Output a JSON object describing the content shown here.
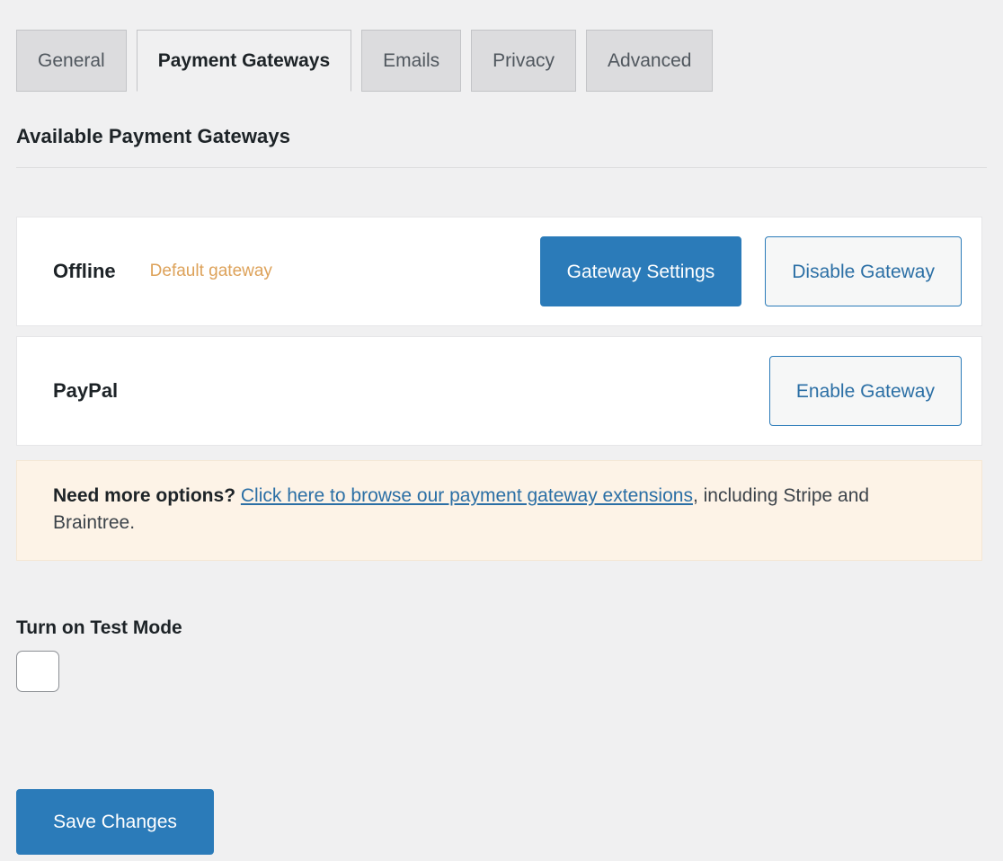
{
  "tabs": [
    {
      "label": "General",
      "active": false
    },
    {
      "label": "Payment Gateways",
      "active": true
    },
    {
      "label": "Emails",
      "active": false
    },
    {
      "label": "Privacy",
      "active": false
    },
    {
      "label": "Advanced",
      "active": false
    }
  ],
  "section": {
    "heading": "Available Payment Gateways"
  },
  "gateways": [
    {
      "name": "Offline",
      "badge": "Default gateway",
      "primary_action": "Gateway Settings",
      "secondary_action": "Disable Gateway"
    },
    {
      "name": "PayPal",
      "badge": "",
      "primary_action": "",
      "secondary_action": "Enable Gateway"
    }
  ],
  "notice": {
    "lead": "Need more options? ",
    "link": "Click here to browse our payment gateway extensions",
    "tail": ", including Stripe and Braintree."
  },
  "test_mode": {
    "label": "Turn on Test Mode",
    "checked": false
  },
  "footer": {
    "save_label": "Save Changes"
  },
  "colors": {
    "page_background": "#f0f0f1",
    "accent_blue": "#2b7bb9",
    "link_blue": "#2b6fa5",
    "badge_orange": "#dda25a",
    "notice_background": "#fdf3e7",
    "tab_inactive_background": "#dcdcde",
    "card_background": "#ffffff"
  }
}
